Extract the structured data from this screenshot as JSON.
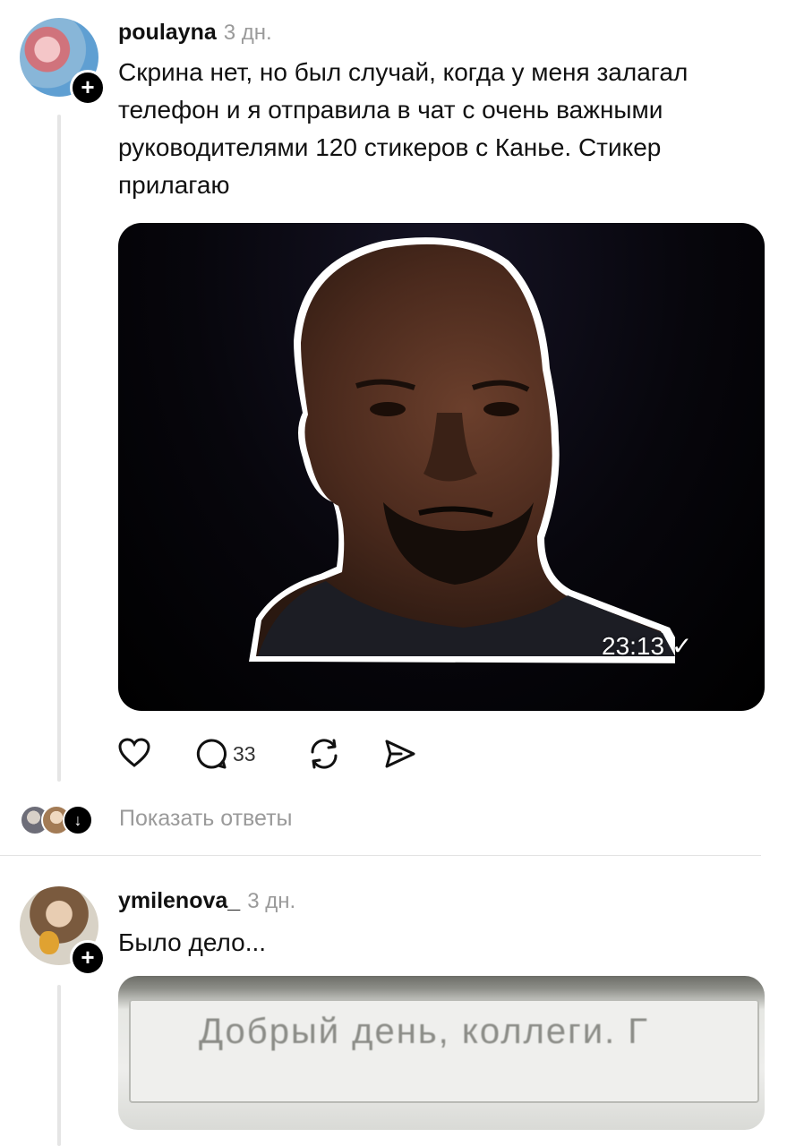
{
  "comments": [
    {
      "username": "poulayna",
      "time": "3 дн.",
      "text": "Скрина нет, но был случай, когда у меня залагал телефон и я отправила в чат с очень важными руководителями 120 стикеров с Канье. Стикер прилагаю",
      "media": {
        "timestamp": "23:13"
      },
      "actions": {
        "reply_count": "33"
      }
    },
    {
      "username": "ymilenova_",
      "time": "3 дн.",
      "text": "Было дело...",
      "media": {
        "screen_text": "Добрый день, коллеги. Г"
      }
    }
  ],
  "replies": {
    "label": "Показать ответы"
  },
  "icons": {
    "follow": "plus-icon",
    "like": "heart-icon",
    "comment": "comment-bubble-icon",
    "repost": "repost-icon",
    "share": "send-icon",
    "expand": "arrow-down-icon",
    "read": "checkmark-icon"
  },
  "colors": {
    "text": "#111111",
    "muted": "#9a9a9a",
    "badge": "#000000"
  }
}
